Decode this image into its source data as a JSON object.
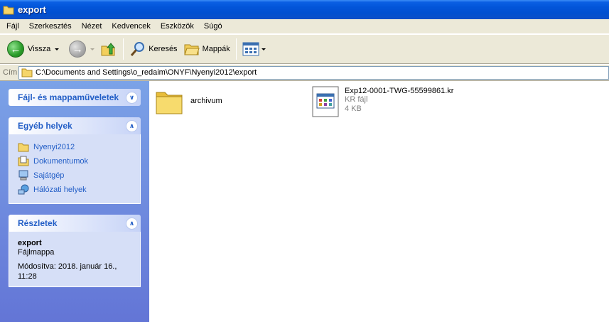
{
  "window": {
    "title": "export"
  },
  "menu": [
    "Fájl",
    "Szerkesztés",
    "Nézet",
    "Kedvencek",
    "Eszközök",
    "Súgó"
  ],
  "toolbar": {
    "back_label": "Vissza",
    "search_label": "Keresés",
    "folders_label": "Mappák"
  },
  "address": {
    "label": "Cím",
    "path": "C:\\Documents and Settings\\o_redaim\\ONYF\\Nyenyi2012\\export"
  },
  "sidebar": {
    "tasks": {
      "title": "Fájl- és mappaműveletek"
    },
    "places": {
      "title": "Egyéb helyek",
      "items": [
        {
          "label": "Nyenyi2012",
          "icon": "folder-icon"
        },
        {
          "label": "Dokumentumok",
          "icon": "documents-icon"
        },
        {
          "label": "Sajátgép",
          "icon": "computer-icon"
        },
        {
          "label": "Hálózati helyek",
          "icon": "network-icon"
        }
      ]
    },
    "details": {
      "title": "Részletek",
      "name": "export",
      "type": "Fájlmappa",
      "modified": "Módosítva: 2018. január 16.,",
      "time": "11:28"
    }
  },
  "files": [
    {
      "name": "archivum",
      "icon": "folder-icon"
    },
    {
      "name": "Exp12-0001-TWG-55599861.kr",
      "type": "KR fájl",
      "size": "4 KB",
      "icon": "kr-file-icon"
    }
  ],
  "colors": {
    "title_blue": "#0254d8",
    "link_blue": "#215dc6",
    "panel_bg": "#d6dff7"
  }
}
